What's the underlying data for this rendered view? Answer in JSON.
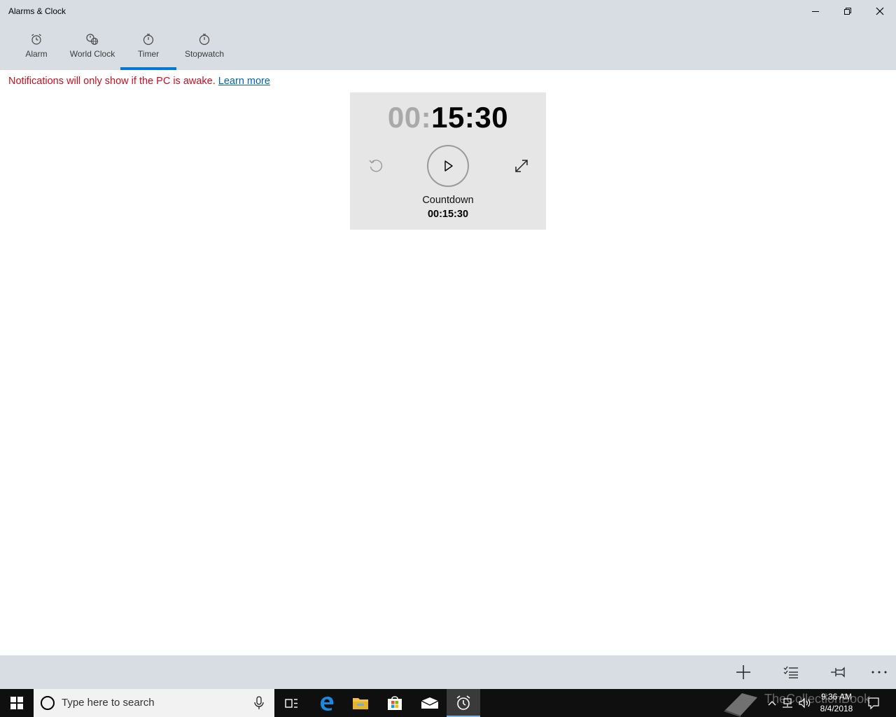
{
  "window": {
    "title": "Alarms & Clock",
    "controls": [
      "minimize-icon",
      "restore-icon",
      "close-icon"
    ]
  },
  "tabs": [
    {
      "label": "Alarm",
      "icon": "alarm-clock-icon"
    },
    {
      "label": "World Clock",
      "icon": "world-clock-icon"
    },
    {
      "label": "Timer",
      "icon": "timer-icon",
      "selected": true
    },
    {
      "label": "Stopwatch",
      "icon": "stopwatch-icon"
    }
  ],
  "notice": {
    "text": "Notifications will only show if the PC is awake.",
    "link": "Learn more"
  },
  "timer": {
    "hours": "00",
    "separator": ":",
    "rest": "15:30",
    "name": "Countdown",
    "duration": "00:15:30",
    "buttons": [
      "reset-icon",
      "play-icon",
      "expand-icon"
    ]
  },
  "appbar": {
    "buttons": [
      "add-icon",
      "select-icon",
      "pin-icon",
      "more-icon"
    ]
  },
  "taskbar": {
    "search_placeholder": "Type here to search",
    "apps": [
      "task-view-icon",
      "edge-icon",
      "file-explorer-icon",
      "store-icon",
      "mail-icon",
      "alarms-icon"
    ],
    "watermark": "TheCollectionBook",
    "time": "9:36 AM",
    "date": "8/4/2018"
  },
  "colors": {
    "accent": "#0078d7",
    "warning": "#c50f1f",
    "link": "#0063b1",
    "chrome": "#d8dde4",
    "card": "#e6e6e6"
  }
}
